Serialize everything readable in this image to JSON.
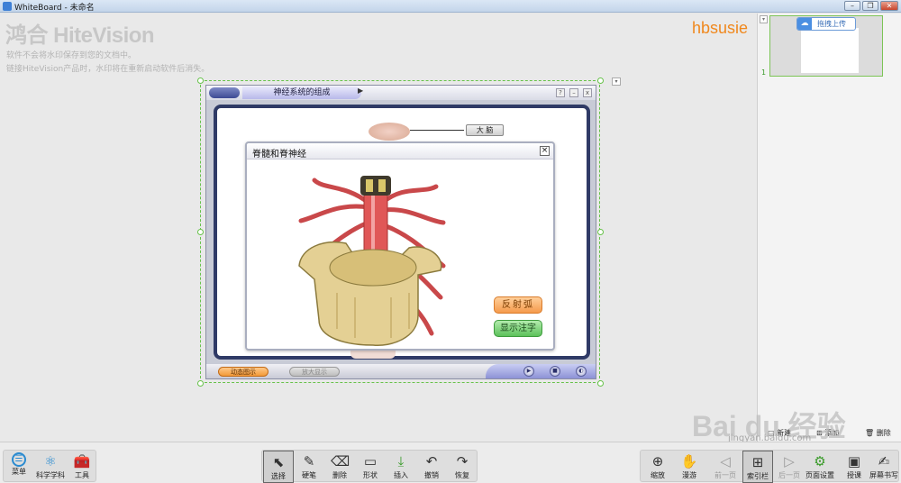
{
  "window": {
    "title": "WhiteBoard - 未命名",
    "buttons": [
      "–",
      "❐",
      "✕"
    ]
  },
  "watermark": {
    "logo": "鸿合 HiteVision",
    "line1": "软件不会将水印保存到您的文档中。",
    "line2": "链接HiteVision产品时，水印将在重新启动软件后消失。",
    "user": "hbsusie"
  },
  "courseware": {
    "tab_title": "神经系统的组成",
    "brain_label": "大  脑",
    "ctl_help": "?",
    "ctl_min": "–",
    "ctl_close": "x",
    "play_marker": "▶",
    "bottom_left": "动态图示",
    "bottom_mid": "放大显示",
    "btn1": "▶",
    "btn2": "■",
    "btn3": "◐"
  },
  "popup": {
    "title": "脊髓和脊神经",
    "close": "×",
    "btn_reflex": "反射弧",
    "btn_labels": "显示注字"
  },
  "sidepanel": {
    "upload_label": "拖拽上传",
    "upload_icon": "☁",
    "page_number": "1",
    "collapse": "▾",
    "actions": [
      {
        "icon": "new-page-icon",
        "label": "新建"
      },
      {
        "icon": "add-page-icon",
        "label": "添加"
      },
      {
        "icon": "trash-icon",
        "label": "删除"
      }
    ]
  },
  "toolbar": {
    "left": [
      {
        "icon": "menu-icon",
        "glyph": "☰",
        "label": "菜单"
      },
      {
        "icon": "science-icon",
        "glyph": "⚛",
        "label": "科学学科"
      },
      {
        "icon": "toolbox-icon",
        "glyph": "🧰",
        "label": "工具"
      }
    ],
    "center": [
      {
        "icon": "pointer-icon",
        "glyph": "⬉",
        "label": "选择",
        "active": true
      },
      {
        "icon": "pen-icon",
        "glyph": "✎",
        "label": "硬笔"
      },
      {
        "icon": "eraser-icon",
        "glyph": "⌫",
        "label": "删除"
      },
      {
        "icon": "shape-icon",
        "glyph": "▭",
        "label": "形状"
      },
      {
        "icon": "insert-icon",
        "glyph": "⤓",
        "label": "插入"
      },
      {
        "icon": "undo-icon",
        "glyph": "↶",
        "label": "撤销"
      },
      {
        "icon": "redo-icon",
        "glyph": "↷",
        "label": "恢复"
      }
    ],
    "right": [
      {
        "icon": "zoom-icon",
        "glyph": "⊕",
        "label": "缩放"
      },
      {
        "icon": "pan-icon",
        "glyph": "✋",
        "label": "漫游"
      },
      {
        "icon": "prev-page-icon",
        "glyph": "◁",
        "label": "前一页",
        "dim": true
      },
      {
        "icon": "index-icon",
        "glyph": "⊞",
        "label": "索引栏",
        "active": true
      },
      {
        "icon": "next-page-icon",
        "glyph": "▷",
        "label": "后一页",
        "dim": true
      },
      {
        "icon": "page-settings-icon",
        "glyph": "⚙",
        "label": "页面设置"
      },
      {
        "icon": "teach-icon",
        "glyph": "▣",
        "label": "授课"
      },
      {
        "icon": "screen-write-icon",
        "glyph": "✍",
        "label": "屏幕书写"
      }
    ]
  },
  "overlay": {
    "baidu": "Bai du 经验",
    "baidu_sub": "jingyan.baidu.com"
  }
}
